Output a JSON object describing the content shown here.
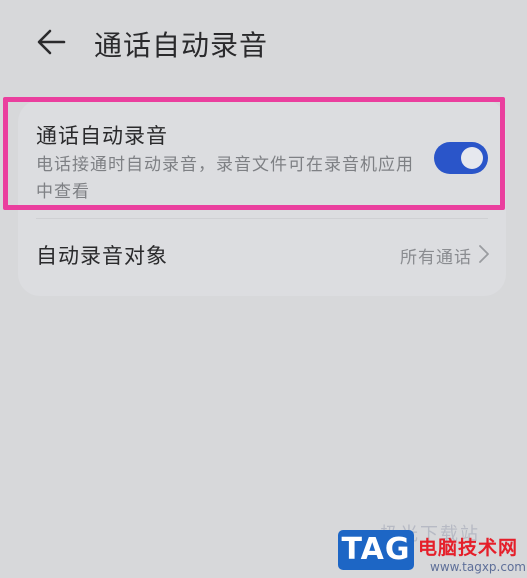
{
  "header": {
    "back_icon": "arrow-left-icon",
    "title": "通话自动录音"
  },
  "settings": {
    "auto_record": {
      "title": "通话自动录音",
      "description": "电话接通时自动录音，录音文件可在录音机应用中查看",
      "enabled": true
    },
    "record_target": {
      "label": "自动录音对象",
      "value": "所有通话",
      "chevron_icon": "chevron-right-icon"
    }
  },
  "colors": {
    "background": "#d7d8da",
    "toggle_on": "#2a55c9",
    "highlight": "#ea3f9e"
  },
  "watermark": {
    "badge": "TAG",
    "site": "电脑技术网",
    "url": "www.tagxp.com",
    "faint": "极光下载站"
  }
}
